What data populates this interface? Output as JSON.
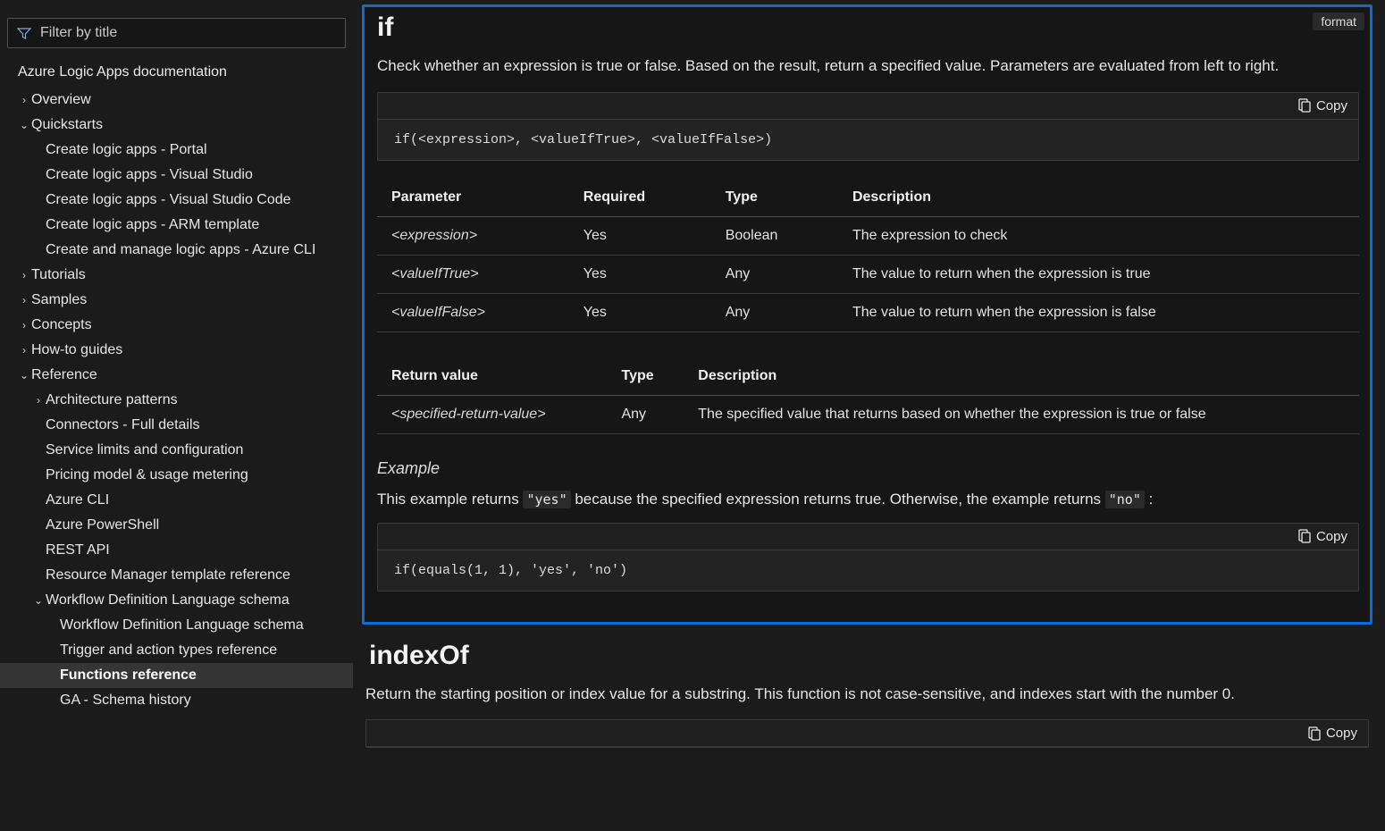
{
  "sidebar": {
    "filter_placeholder": "Filter by title",
    "root": "Azure Logic Apps documentation",
    "items": [
      {
        "label": "Overview",
        "chev": "right",
        "depth": 1
      },
      {
        "label": "Quickstarts",
        "chev": "down",
        "depth": 1
      },
      {
        "label": "Create logic apps - Portal",
        "chev": "",
        "depth": 2
      },
      {
        "label": "Create logic apps - Visual Studio",
        "chev": "",
        "depth": 2
      },
      {
        "label": "Create logic apps - Visual Studio Code",
        "chev": "",
        "depth": 2
      },
      {
        "label": "Create logic apps - ARM template",
        "chev": "",
        "depth": 2
      },
      {
        "label": "Create and manage logic apps - Azure CLI",
        "chev": "",
        "depth": 2
      },
      {
        "label": "Tutorials",
        "chev": "right",
        "depth": 1
      },
      {
        "label": "Samples",
        "chev": "right",
        "depth": 1
      },
      {
        "label": "Concepts",
        "chev": "right",
        "depth": 1
      },
      {
        "label": "How-to guides",
        "chev": "right",
        "depth": 1
      },
      {
        "label": "Reference",
        "chev": "down",
        "depth": 1
      },
      {
        "label": "Architecture patterns",
        "chev": "right",
        "depth": 2
      },
      {
        "label": "Connectors - Full details",
        "chev": "",
        "depth": 2
      },
      {
        "label": "Service limits and configuration",
        "chev": "",
        "depth": 2
      },
      {
        "label": "Pricing model & usage metering",
        "chev": "",
        "depth": 2
      },
      {
        "label": "Azure CLI",
        "chev": "",
        "depth": 2
      },
      {
        "label": "Azure PowerShell",
        "chev": "",
        "depth": 2
      },
      {
        "label": "REST API",
        "chev": "",
        "depth": 2
      },
      {
        "label": "Resource Manager template reference",
        "chev": "",
        "depth": 2
      },
      {
        "label": "Workflow Definition Language schema",
        "chev": "down",
        "depth": 2
      },
      {
        "label": "Workflow Definition Language schema",
        "chev": "",
        "depth": 3
      },
      {
        "label": "Trigger and action types reference",
        "chev": "",
        "depth": 3
      },
      {
        "label": "Functions reference",
        "chev": "",
        "depth": 3,
        "selected": true
      },
      {
        "label": "GA - Schema history",
        "chev": "",
        "depth": 3
      }
    ]
  },
  "main": {
    "format_tag": "format",
    "copy_label": "Copy",
    "if_section": {
      "title": "if",
      "desc": "Check whether an expression is true or false. Based on the result, return a specified value. Parameters are evaluated from left to right.",
      "code1": "if(<expression>, <valueIfTrue>, <valueIfFalse>)",
      "param_headers": [
        "Parameter",
        "Required",
        "Type",
        "Description"
      ],
      "params": [
        {
          "name": "<expression>",
          "required": "Yes",
          "type": "Boolean",
          "desc": "The expression to check"
        },
        {
          "name": "<valueIfTrue>",
          "required": "Yes",
          "type": "Any",
          "desc": "The value to return when the expression is true"
        },
        {
          "name": "<valueIfFalse>",
          "required": "Yes",
          "type": "Any",
          "desc": "The value to return when the expression is false"
        }
      ],
      "return_headers": [
        "Return value",
        "Type",
        "Description"
      ],
      "returns": [
        {
          "name": "<specified-return-value>",
          "type": "Any",
          "desc": "The specified value that returns based on whether the expression is true or false"
        }
      ],
      "example_heading": "Example",
      "example_pre": "This example returns ",
      "example_code_yes": "\"yes\"",
      "example_mid": " because the specified expression returns true. Otherwise, the example returns ",
      "example_code_no": "\"no\"",
      "example_post": " :",
      "code2": "if(equals(1, 1), 'yes', 'no')"
    },
    "indexof_section": {
      "title": "indexOf",
      "desc": "Return the starting position or index value for a substring. This function is not case-sensitive, and indexes start with the number 0."
    }
  }
}
